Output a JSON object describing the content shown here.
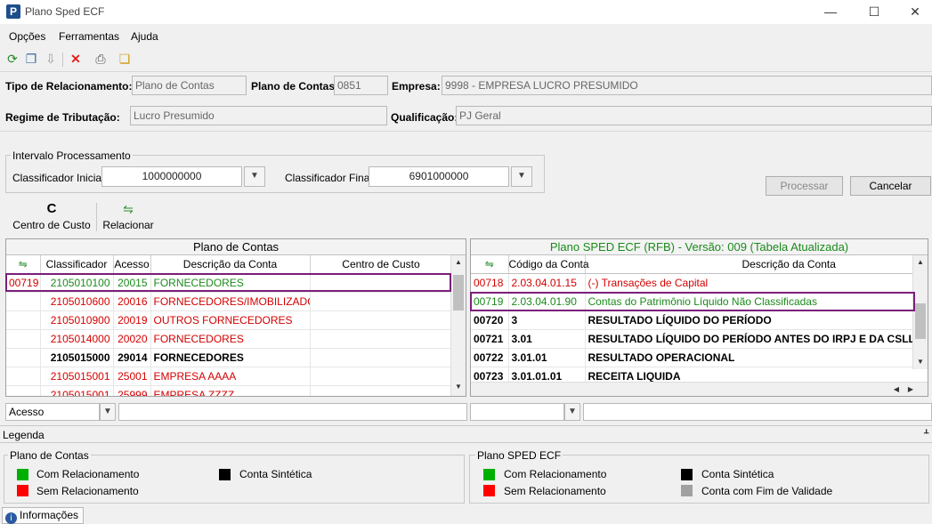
{
  "window": {
    "title": "Plano Sped ECF",
    "minimize": "—",
    "maximize": "☐",
    "close": "✕"
  },
  "menu": [
    "Opções",
    "Ferramentas",
    "Ajuda"
  ],
  "header": {
    "tipo_label": "Tipo de Relacionamento:",
    "tipo_value": "Plano de Contas",
    "plano_label": "Plano de Contas:",
    "plano_value": "0851",
    "empresa_label": "Empresa:",
    "empresa_value": "9998 - EMPRESA LUCRO PRESUMIDO",
    "regime_label": "Regime de Tributação:",
    "regime_value": "Lucro Presumido",
    "qualif_label": "Qualificação:",
    "qualif_value": "PJ Geral"
  },
  "intervalo": {
    "title": "Intervalo Processamento",
    "inicial_label": "Classificador Inicial:",
    "inicial_value": "1000000000",
    "final_label": "Classificador Final:",
    "final_value": "6901000000"
  },
  "buttons": {
    "processar": "Processar",
    "cancelar": "Cancelar",
    "centro": "Centro de Custo",
    "relacionar": "Relacionar",
    "centro_icon": "C"
  },
  "left_grid": {
    "title": "Plano de Contas",
    "columns": [
      "Classificador",
      "Acesso",
      "Descrição da Conta",
      "Centro de Custo"
    ],
    "rows": [
      {
        "code": "00719",
        "classificador": "2105010100",
        "acesso": "20015",
        "descricao": "FORNECEDORES",
        "centro": "",
        "style": "green"
      },
      {
        "code": "",
        "classificador": "2105010600",
        "acesso": "20016",
        "descricao": "FORNECEDORES/IMOBILIZADO",
        "centro": "",
        "style": "red"
      },
      {
        "code": "",
        "classificador": "2105010900",
        "acesso": "20019",
        "descricao": "OUTROS FORNECEDORES",
        "centro": "",
        "style": "red"
      },
      {
        "code": "",
        "classificador": "2105014000",
        "acesso": "20020",
        "descricao": "FORNECEDORES",
        "centro": "",
        "style": "red"
      },
      {
        "code": "",
        "classificador": "2105015000",
        "acesso": "29014",
        "descricao": "FORNECEDORES",
        "centro": "",
        "style": "bold"
      },
      {
        "code": "",
        "classificador": "2105015001",
        "acesso": "25001",
        "descricao": "EMPRESA AAAA",
        "centro": "",
        "style": "red"
      },
      {
        "code": "",
        "classificador": "2105015001",
        "acesso": "25999",
        "descricao": "EMPRESA ZZZZ",
        "centro": "",
        "style": "red"
      }
    ]
  },
  "right_grid": {
    "title": "Plano SPED ECF (RFB) - Versão: 009 (Tabela Atualizada)",
    "columns": [
      "Código da Conta",
      "Descrição da Conta"
    ],
    "rows": [
      {
        "code": "00718",
        "codigo": "2.03.04.01.15",
        "descricao": "(-) Transações de Capital",
        "style": "red"
      },
      {
        "code": "00719",
        "codigo": "2.03.04.01.90",
        "descricao": "Contas do Patrimônio Líquido Não Classificadas",
        "style": "green"
      },
      {
        "code": "00720",
        "codigo": "3",
        "descricao": "RESULTADO LÍQUIDO DO PERÍODO",
        "style": "bold"
      },
      {
        "code": "00721",
        "codigo": "3.01",
        "descricao": "RESULTADO LÍQUIDO DO PERÍODO ANTES DO IRPJ E DA CSLL - ATIV",
        "style": "bold"
      },
      {
        "code": "00722",
        "codigo": "3.01.01",
        "descricao": "RESULTADO OPERACIONAL",
        "style": "bold"
      },
      {
        "code": "00723",
        "codigo": "3.01.01.01",
        "descricao": "RECEITA LIQUIDA",
        "style": "bold"
      }
    ]
  },
  "filter": {
    "left_value": "Acesso"
  },
  "legenda": {
    "title": "Legenda",
    "pin": "ᚆ",
    "plano_title": "Plano de Contas",
    "sped_title": "Plano SPED ECF",
    "com": "Com Relacionamento",
    "sem": "Sem Relacionamento",
    "sintetica": "Conta Sintética",
    "fim": "Conta com Fim de Validade",
    "colors": {
      "green": "#00b000",
      "red": "#ff0000",
      "black": "#000000",
      "gray": "#a0a0a0"
    }
  },
  "status": {
    "info": "Informações"
  }
}
